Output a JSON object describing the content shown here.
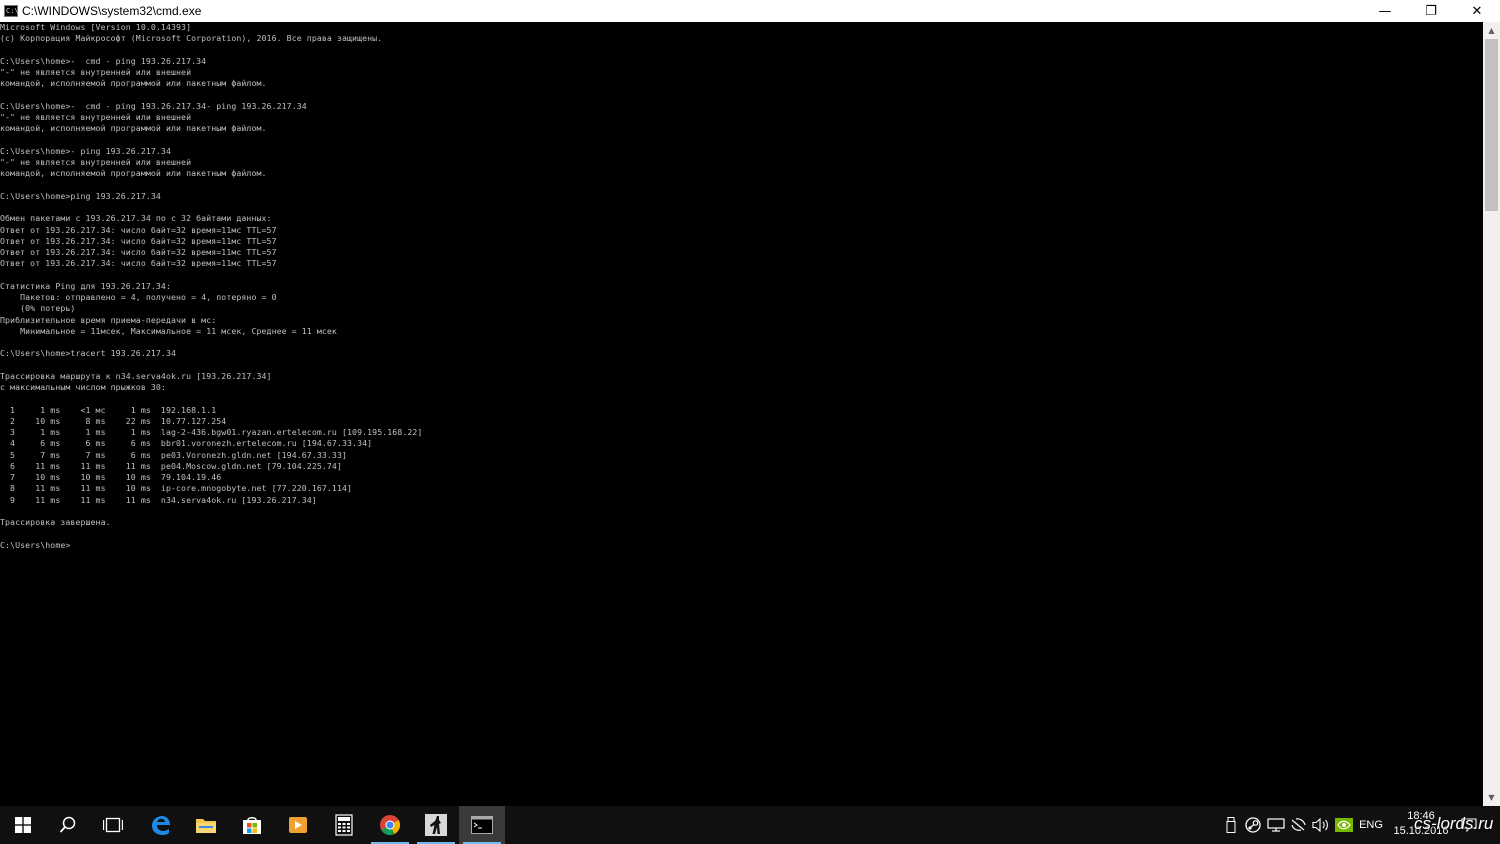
{
  "window": {
    "title": "C:\\WINDOWS\\system32\\cmd.exe",
    "icon_label": "C:\\",
    "minimize": "—",
    "restore": "❐",
    "close": "✕"
  },
  "console_lines": [
    "Microsoft Windows [Version 10.0.14393]",
    "(c) Корпорация Майкрософт (Microsoft Corporation), 2016. Все права защищены.",
    "",
    "C:\\Users\\home>-  cmd - ping 193.26.217.34",
    "\"-\" не является внутренней или внешней",
    "командой, исполняемой программой или пакетным файлом.",
    "",
    "C:\\Users\\home>-  cmd - ping 193.26.217.34- ping 193.26.217.34",
    "\"-\" не является внутренней или внешней",
    "командой, исполняемой программой или пакетным файлом.",
    "",
    "C:\\Users\\home>- ping 193.26.217.34",
    "\"-\" не является внутренней или внешней",
    "командой, исполняемой программой или пакетным файлом.",
    "",
    "C:\\Users\\home>ping 193.26.217.34",
    "",
    "Обмен пакетами с 193.26.217.34 по с 32 байтами данных:",
    "Ответ от 193.26.217.34: число байт=32 время=11мс TTL=57",
    "Ответ от 193.26.217.34: число байт=32 время=11мс TTL=57",
    "Ответ от 193.26.217.34: число байт=32 время=11мс TTL=57",
    "Ответ от 193.26.217.34: число байт=32 время=11мс TTL=57",
    "",
    "Статистика Ping для 193.26.217.34:",
    "    Пакетов: отправлено = 4, получено = 4, потеряно = 0",
    "    (0% потерь)",
    "Приблизительное время приема-передачи в мс:",
    "    Минимальное = 11мсек, Максимальное = 11 мсек, Среднее = 11 мсек",
    "",
    "C:\\Users\\home>tracert 193.26.217.34",
    "",
    "Трассировка маршрута к n34.serva4ok.ru [193.26.217.34]",
    "с максимальным числом прыжков 30:",
    "",
    "  1     1 ms    <1 мс     1 ms  192.168.1.1",
    "  2    10 ms     8 ms    22 ms  10.77.127.254",
    "  3     1 ms     1 ms     1 ms  lag-2-436.bgw01.ryazan.ertelecom.ru [109.195.168.22]",
    "  4     6 ms     6 ms     6 ms  bbr01.voronezh.ertelecom.ru [194.67.33.34]",
    "  5     7 ms     7 ms     6 ms  pe03.Voronezh.gldn.net [194.67.33.33]",
    "  6    11 ms    11 ms    11 ms  pe04.Moscow.gldn.net [79.104.225.74]",
    "  7    10 ms    10 ms    10 ms  79.104.19.46",
    "  8    11 ms    11 ms    10 ms  ip-core.mnogobyte.net [77.220.167.114]",
    "  9    11 ms    11 ms    11 ms  n34.serva4ok.ru [193.26.217.34]",
    "",
    "Трассировка завершена.",
    "",
    "C:\\Users\\home>"
  ],
  "scrollbar": {
    "up": "▲",
    "down": "▼",
    "position": 0.0
  },
  "taskbar": {
    "items": [
      {
        "name": "start-icon",
        "active": false
      },
      {
        "name": "search-icon",
        "active": false
      },
      {
        "name": "task-view-icon",
        "active": false
      },
      {
        "name": "edge-icon",
        "active": false
      },
      {
        "name": "file-explorer-icon",
        "active": false
      },
      {
        "name": "store-icon",
        "active": false
      },
      {
        "name": "media-player-icon",
        "active": false
      },
      {
        "name": "calculator-icon",
        "active": false
      },
      {
        "name": "chrome-icon",
        "active": true
      },
      {
        "name": "counter-strike-icon",
        "active": true
      },
      {
        "name": "cmd-icon",
        "active": true
      }
    ],
    "tray": {
      "language": "ENG",
      "time": "18:46",
      "date": "15.10.2016"
    }
  },
  "watermark": "cs-lords.ru",
  "colors": {
    "console_bg": "#000000",
    "console_text": "#c0c0c0",
    "taskbar_bg": "#101010",
    "accent": "#76b9ed"
  }
}
